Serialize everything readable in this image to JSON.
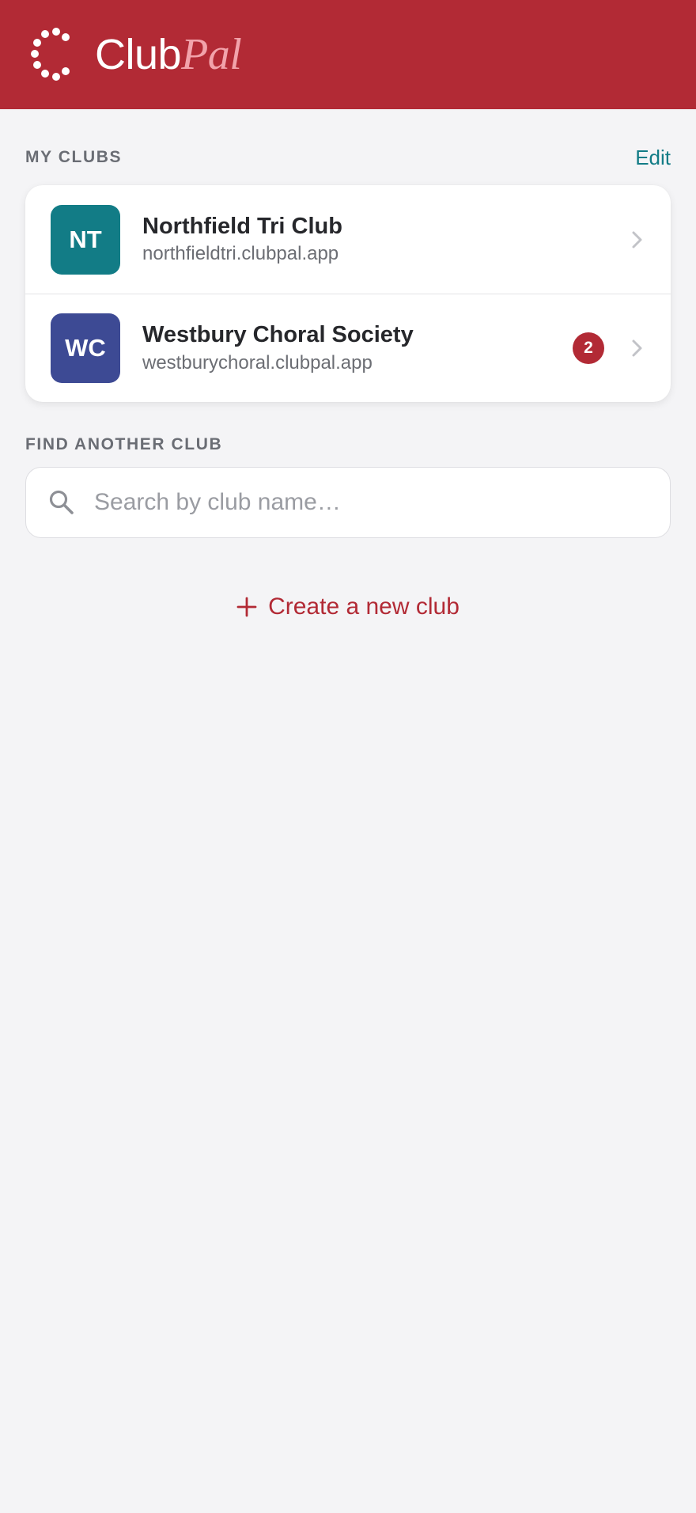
{
  "app": {
    "brand_club": "Club",
    "brand_pal": "Pal",
    "logo_icon": "dotted-circle-logo",
    "brand_color": "#b22a35"
  },
  "my_clubs": {
    "section_label": "MY CLUBS",
    "edit_label": "Edit",
    "clubs": [
      {
        "initials": "NT",
        "name": "Northfield Tri Club",
        "url": "northfieldtri.clubpal.app",
        "avatar_color": "#127c86",
        "badge": null
      },
      {
        "initials": "WC",
        "name": "Westbury Choral Society",
        "url": "westburychoral.clubpal.app",
        "avatar_color": "#3d4a94",
        "badge": "2"
      }
    ]
  },
  "find": {
    "section_label": "FIND ANOTHER CLUB",
    "search_placeholder": "Search by club name…",
    "search_value": ""
  },
  "create": {
    "label": "Create a new club"
  },
  "icons": {
    "search": "search-icon",
    "chevron": "chevron-right-icon",
    "plus": "plus-icon"
  }
}
